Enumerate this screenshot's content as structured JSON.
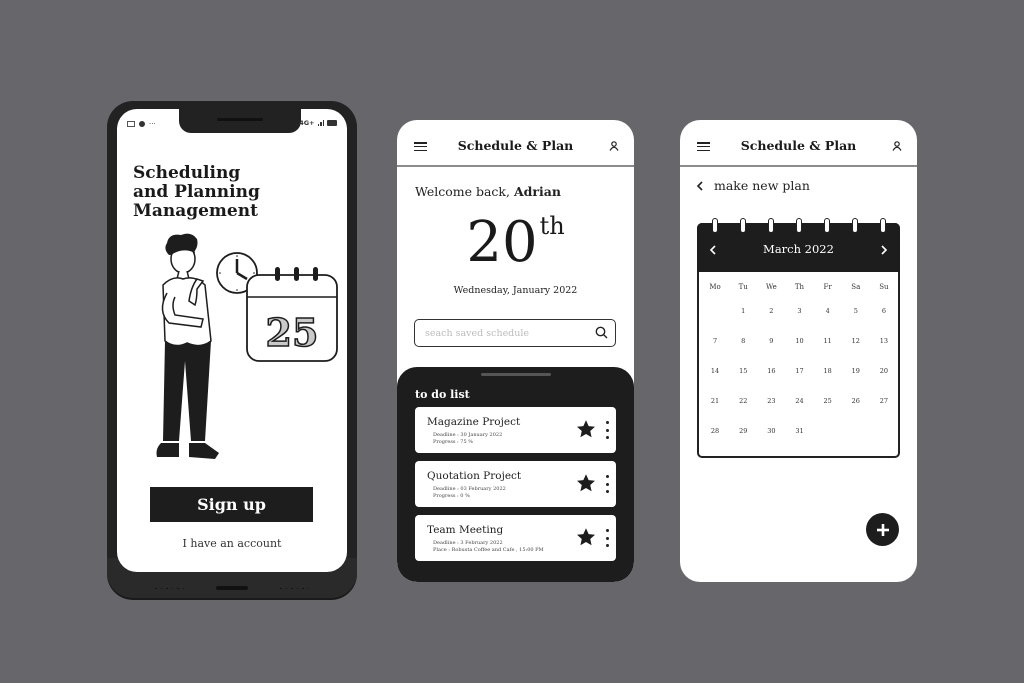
{
  "colors": {
    "background": "#67666b",
    "dark": "#1d1d1d",
    "screen": "#ffffff"
  },
  "onboarding": {
    "status_bar": {
      "left_icons": [
        "mail-icon",
        "chat-icon",
        "more-dots"
      ],
      "dots": "···",
      "network": "4G+",
      "right_icons": [
        "signal-icon",
        "battery-icon"
      ]
    },
    "title_lines": [
      "Scheduling",
      "and Planning",
      "Management"
    ],
    "illustration": {
      "calendar_number": "25",
      "icons": [
        "person-thinking",
        "clock-icon",
        "calendar-icon"
      ]
    },
    "signup_label": "Sign up",
    "account_link": "I have an account"
  },
  "home": {
    "header": {
      "title": "Schedule & Plan",
      "menu_icon": "hamburger-icon",
      "user_icon": "user-icon"
    },
    "welcome_prefix": "Welcome back, ",
    "user_name": "Adrian",
    "day": "20",
    "day_suffix": "th",
    "date_line": "Wednesday, January 2022",
    "search": {
      "placeholder": "seach saved schedule",
      "value": ""
    },
    "todo": {
      "title": "to do list",
      "items": [
        {
          "name": "Magazine Project",
          "line1": "Deadline : 30 January 2022",
          "line2": "Progress : 75 %",
          "starred": true
        },
        {
          "name": "Quotation Project",
          "line1": "Deadline : 03 February 2022",
          "line2": "Progress : 0 %",
          "starred": true
        },
        {
          "name": "Team Meeting",
          "line1": "Deadline : 3 February 2022",
          "line2": "Place : Robusta Coffee and Cafe , 15:00 PM",
          "starred": true
        }
      ]
    }
  },
  "planner": {
    "header": {
      "title": "Schedule & Plan",
      "menu_icon": "hamburger-icon",
      "user_icon": "user-icon"
    },
    "back_label": "make new plan",
    "calendar": {
      "month_label": "March 2022",
      "weekdays": [
        "Mo",
        "Tu",
        "We",
        "Th",
        "Fr",
        "Sa",
        "Su"
      ],
      "leading_blanks": 1,
      "days": [
        "1",
        "2",
        "3",
        "4",
        "5",
        "6",
        "7",
        "8",
        "9",
        "10",
        "11",
        "12",
        "13",
        "14",
        "15",
        "16",
        "17",
        "18",
        "19",
        "20",
        "21",
        "22",
        "23",
        "24",
        "25",
        "26",
        "27",
        "28",
        "29",
        "30",
        "31"
      ]
    },
    "fab_icon": "plus-icon"
  }
}
